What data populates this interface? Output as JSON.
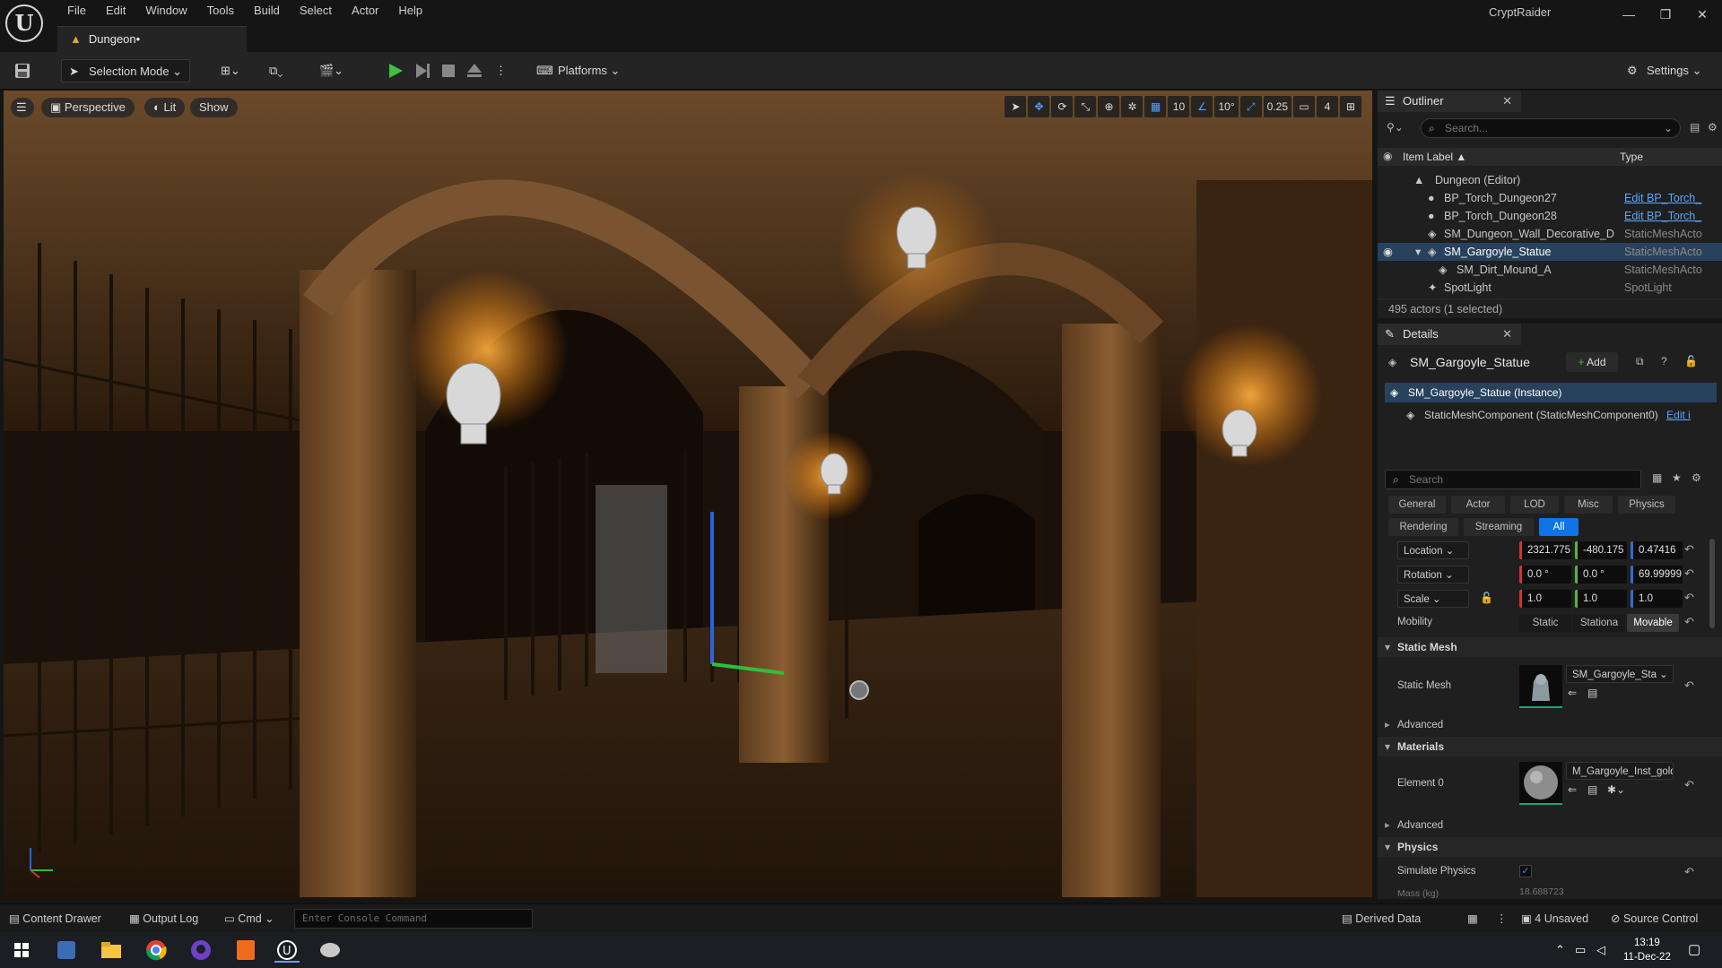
{
  "app": {
    "menu": [
      "File",
      "Edit",
      "Window",
      "Tools",
      "Build",
      "Select",
      "Actor",
      "Help"
    ],
    "doc_tab": "Dungeon•",
    "project_name": "CryptRaider"
  },
  "toolbar": {
    "selection_mode": "Selection Mode",
    "platforms": "Platforms",
    "settings": "Settings"
  },
  "viewport": {
    "perspective": "Perspective",
    "lit": "Lit",
    "show": "Show",
    "grid_snap": "10",
    "rotation_snap": "10°",
    "scale_snap": "0.25",
    "camera_speed": "4"
  },
  "outliner": {
    "title": "Outliner",
    "search_placeholder": "Search...",
    "col_label": "Item Label ▲",
    "col_type": "Type",
    "rows": [
      {
        "label": "Dungeon (Editor)",
        "type": ""
      },
      {
        "label": "BP_Torch_Dungeon27",
        "type": "Edit BP_Torch_"
      },
      {
        "label": "BP_Torch_Dungeon28",
        "type": "Edit BP_Torch_"
      },
      {
        "label": "SM_Dungeon_Wall_Decorative_D",
        "type": "StaticMeshActo"
      },
      {
        "label": "SM_Gargoyle_Statue",
        "type": "StaticMeshActo"
      },
      {
        "label": "SM_Dirt_Mound_A",
        "type": "StaticMeshActo"
      },
      {
        "label": "SpotLight",
        "type": "SpotLight"
      }
    ],
    "status": "495 actors (1 selected)"
  },
  "details": {
    "title": "Details",
    "actor_name": "SM_Gargoyle_Statue",
    "add_label": "Add",
    "instance_label": "SM_Gargoyle_Statue (Instance)",
    "component_label": "StaticMeshComponent (StaticMeshComponent0)",
    "component_edit": "Edit i",
    "search_placeholder": "Search",
    "filters_row1": [
      "General",
      "Actor",
      "LOD",
      "Misc",
      "Physics"
    ],
    "filters_row2": [
      "Rendering",
      "Streaming",
      "All"
    ],
    "location": {
      "label": "Location",
      "x": "2321.775",
      "y": "-480.175",
      "z": "0.47416"
    },
    "rotation": {
      "label": "Rotation",
      "x": "0.0 °",
      "y": "0.0 °",
      "z": "69.99999"
    },
    "scale": {
      "label": "Scale",
      "x": "1.0",
      "y": "1.0",
      "z": "1.0"
    },
    "mobility": {
      "label": "Mobility",
      "options": [
        "Static",
        "Stationa",
        "Movable"
      ]
    },
    "static_mesh_section": "Static Mesh",
    "static_mesh_label": "Static Mesh",
    "static_mesh_value": "SM_Gargoyle_Sta",
    "advanced": "Advanced",
    "materials_section": "Materials",
    "element0_label": "Element 0",
    "element0_value": "M_Gargoyle_Inst_gold",
    "physics_section": "Physics",
    "simulate_physics": "Simulate Physics",
    "mass_label": "Mass (kg)",
    "mass_value": "18.688723"
  },
  "statusbar": {
    "content_drawer": "Content Drawer",
    "output_log": "Output Log",
    "cmd": "Cmd",
    "console_placeholder": "Enter Console Command",
    "derived_data": "Derived Data",
    "unsaved": "4 Unsaved",
    "source_control": "Source Control"
  },
  "taskbar": {
    "time": "13:19",
    "date": "11-Dec-22"
  },
  "colors": {
    "accent": "#0f74e6",
    "selection": "#28425e",
    "play_green": "#3fbf3f"
  }
}
